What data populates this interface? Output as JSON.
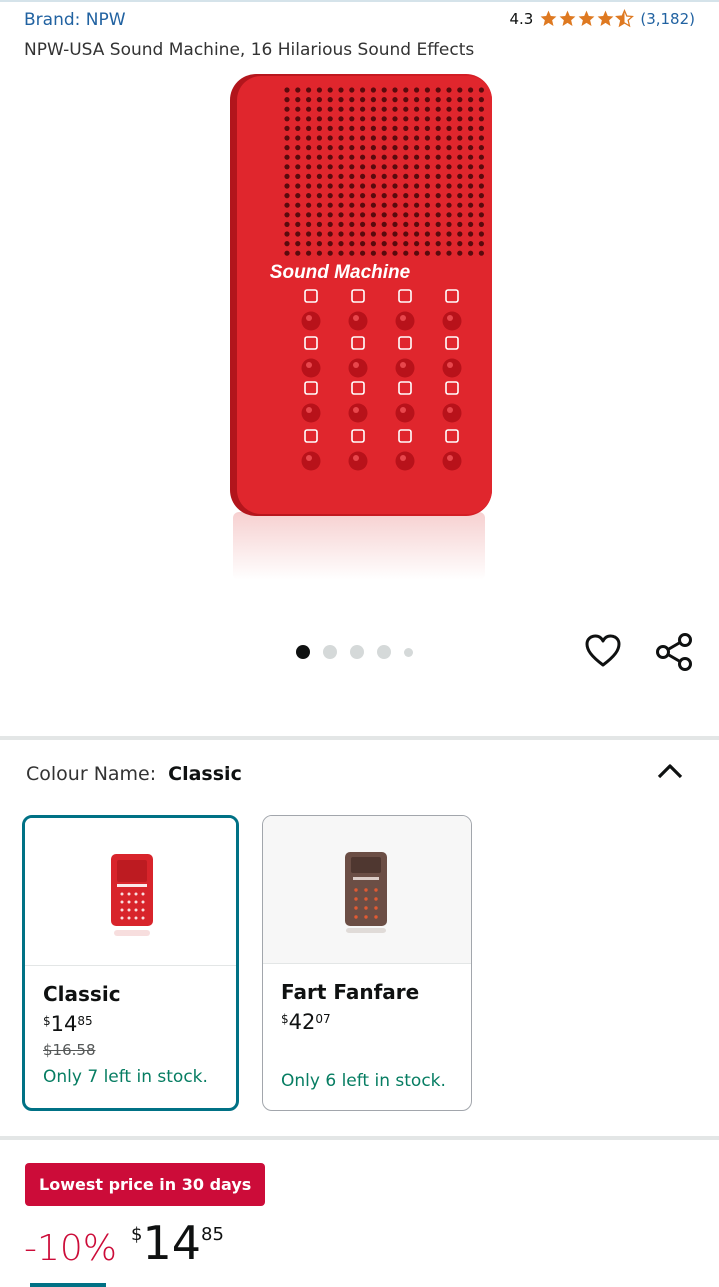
{
  "header": {
    "brand": "Brand: NPW",
    "rating_value": "4.3",
    "rating_stars": 4.3,
    "rating_count": "(3,182)",
    "title": "NPW-USA Sound Machine, 16 Hilarious Sound Effects"
  },
  "product_image": {
    "label": "Sound Machine",
    "color": "#d81f26"
  },
  "carousel": {
    "total": 5,
    "active_index": 0
  },
  "colour": {
    "label": "Colour Name:",
    "value": "Classic"
  },
  "swatches": [
    {
      "name": "Classic",
      "price_currency": "$",
      "price_whole": "14",
      "price_fraction": "85",
      "list_price": "$16.58",
      "stock": "Only 7 left in stock."
    },
    {
      "name": "Fart Fanfare",
      "price_currency": "$",
      "price_whole": "42",
      "price_fraction": "07",
      "stock": "Only 6 left in stock."
    }
  ],
  "deal": {
    "badge": "Lowest price in 30 days",
    "discount": "-10%",
    "currency": "$",
    "whole": "14",
    "fraction": "85"
  },
  "colors": {
    "accent": "#007185",
    "deal_red": "#cc0c39",
    "star": "#de7921",
    "link": "#2162a1"
  }
}
